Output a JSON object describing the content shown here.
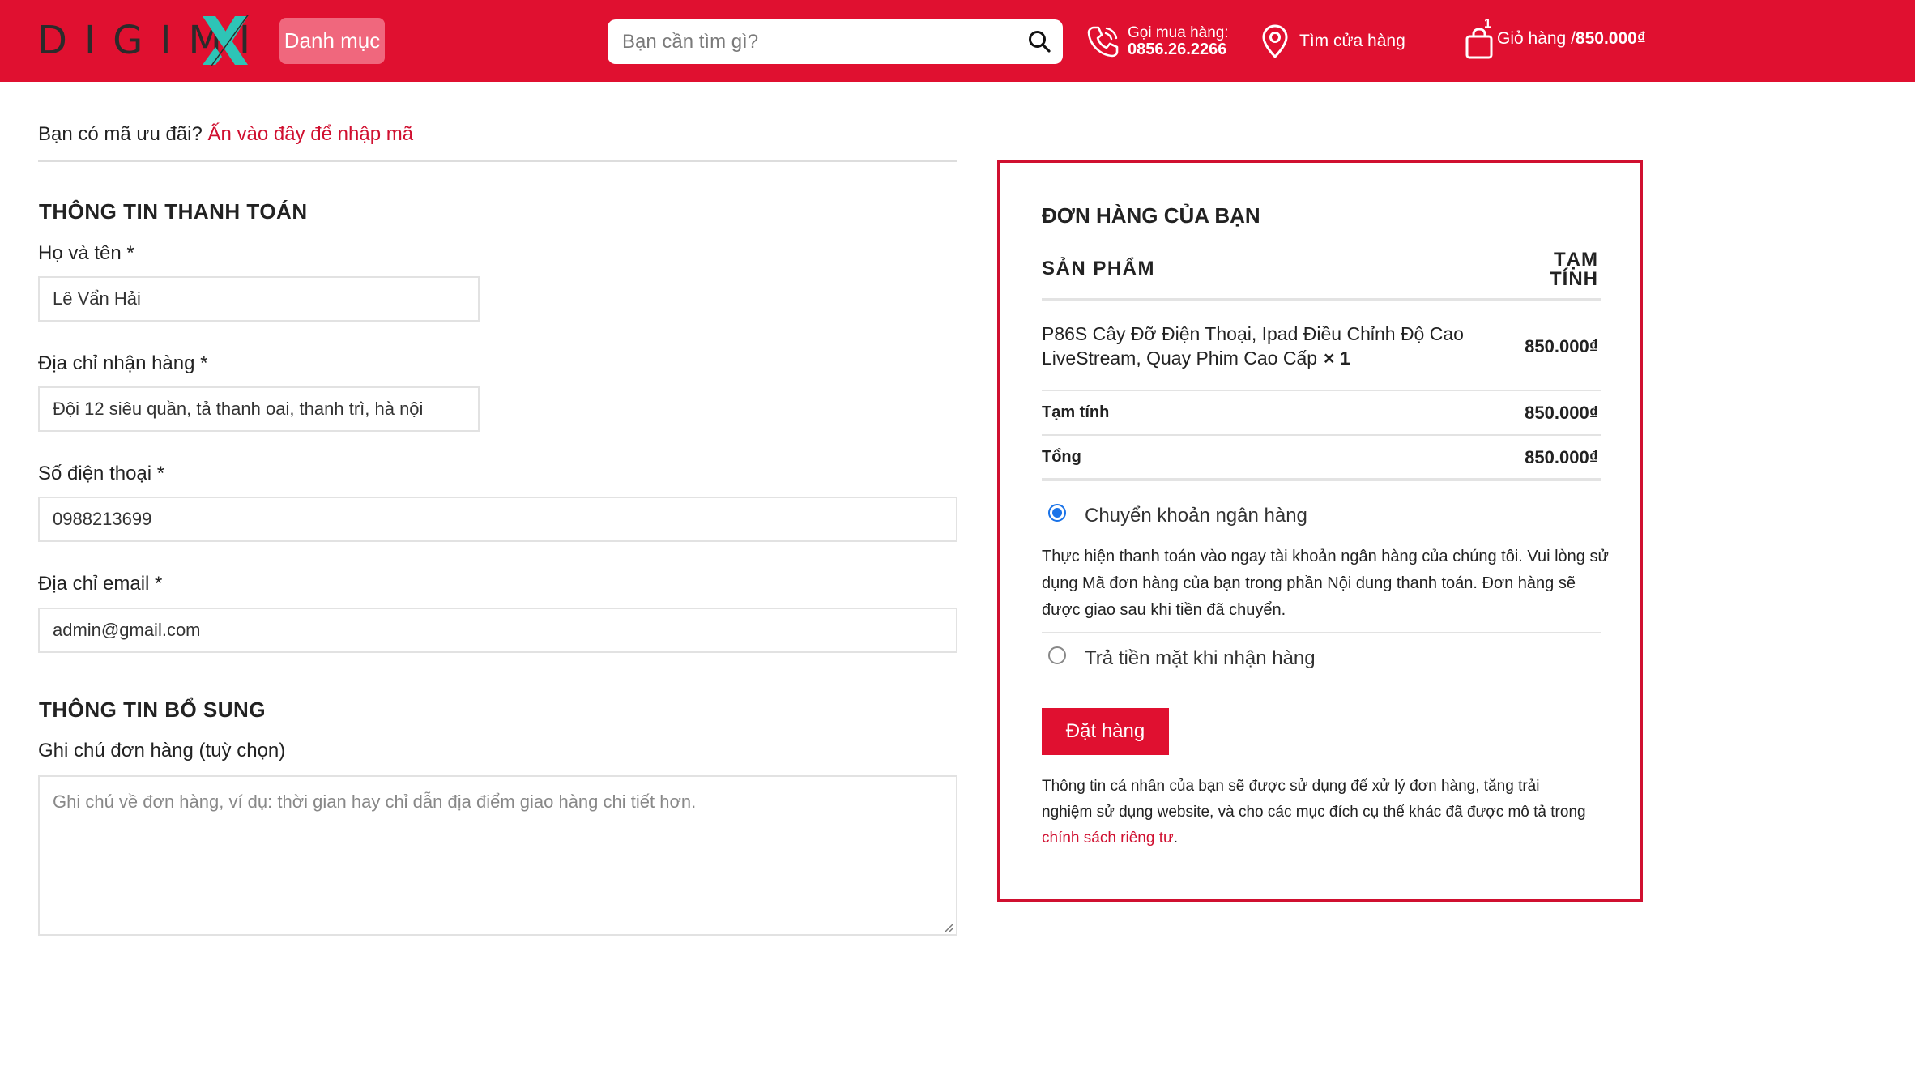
{
  "header": {
    "logo_text": "DIGIMI",
    "logo_x": "X",
    "category_button": "Danh mục",
    "search_placeholder": "Bạn cần tìm gì?",
    "hotline_label": "Gọi mua hàng:",
    "hotline_number": "0856.26.2266",
    "store_label": "Tìm cửa hàng",
    "cart_count": "1",
    "cart_label": "Giỏ hàng / ",
    "cart_total": "850.000₫",
    "colors": {
      "brand_red": "#e01030",
      "logo_x": "#2ec4b6"
    },
    "icons": [
      "search-icon",
      "phone-icon",
      "location-pin-icon",
      "shopping-bag-icon"
    ]
  },
  "coupon": {
    "prompt": "Bạn có mã ưu đãi? ",
    "link": "Ấn vào đây để nhập mã"
  },
  "billing": {
    "title": "THÔNG TIN THANH TOÁN",
    "fields": [
      {
        "label": "Họ và tên *",
        "value": "Lê Vẩn Hải"
      },
      {
        "label": "Địa chỉ nhận hàng *",
        "value": "Đội 12 siêu quần, tả thanh oai, thanh trì, hà nội"
      },
      {
        "label": "Số điện thoại *",
        "value": "0988213699"
      },
      {
        "label": "Địa chỉ email *",
        "value": "admin@gmail.com"
      }
    ]
  },
  "additional": {
    "title": "THÔNG TIN BỔ SUNG",
    "note_label": "Ghi chú đơn hàng (tuỳ chọn)",
    "note_placeholder": "Ghi chú về đơn hàng, ví dụ: thời gian hay chỉ dẫn địa điểm giao hàng chi tiết hơn."
  },
  "order": {
    "title": "ĐƠN HÀNG CỦA BẠN",
    "col_product": "SẢN PHẨM",
    "col_subtotal_line1": "TẠM",
    "col_subtotal_line2": "TÍNH",
    "product_name": "P86S Cây Đỡ Điện Thoại, Ipad Điều Chỉnh Độ Cao LiveStream, Quay Phim Cao Cấp",
    "product_qty": "× 1",
    "product_price": "850.000₫",
    "subtotal_label": "Tạm tính",
    "subtotal_value": "850.000₫",
    "total_label": "Tổng",
    "total_value": "850.000₫",
    "payment_methods": [
      {
        "label": "Chuyển khoản ngân hàng",
        "selected": true
      },
      {
        "label": "Trả tiền mặt khi nhận hàng",
        "selected": false
      }
    ],
    "bank_description": "Thực hiện thanh toán vào ngay tài khoản ngân hàng của chúng tôi. Vui lòng sử dụng Mã đơn hàng của bạn trong phần Nội dung thanh toán. Đơn hàng sẽ được giao sau khi tiền đã chuyển.",
    "place_order_button": "Đặt hàng",
    "privacy_text": "Thông tin cá nhân của bạn sẽ được sử dụng để xử lý đơn hàng, tăng trải nghiệm sử dụng website, và cho các mục đích cụ thể khác đã được mô tả trong ",
    "privacy_link": "chính sách riêng tư",
    "privacy_end": "."
  }
}
